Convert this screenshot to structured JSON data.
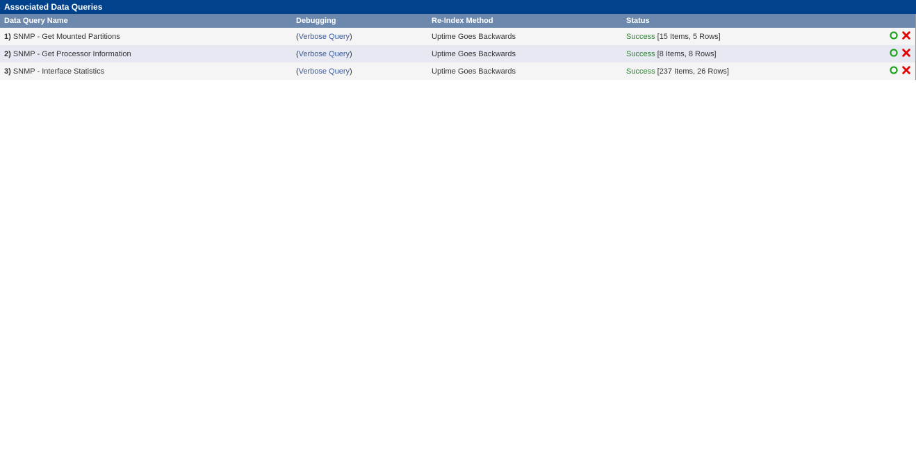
{
  "panel": {
    "title": "Associated Data Queries"
  },
  "table": {
    "headers": {
      "name": "Data Query Name",
      "debugging": "Debugging",
      "reindex": "Re-Index Method",
      "status": "Status"
    },
    "verbose_label": "Verbose Query",
    "rows": [
      {
        "num": "1)",
        "name": "SNMP - Get Mounted Partitions",
        "reindex": "Uptime Goes Backwards",
        "status_label": "Success",
        "status_detail": "[15 Items, 5 Rows]"
      },
      {
        "num": "2)",
        "name": "SNMP - Get Processor Information",
        "reindex": "Uptime Goes Backwards",
        "status_label": "Success",
        "status_detail": "[8 Items, 8 Rows]"
      },
      {
        "num": "3)",
        "name": "SNMP - Interface Statistics",
        "reindex": "Uptime Goes Backwards",
        "status_label": "Success",
        "status_detail": "[237 Items, 26 Rows]"
      }
    ]
  }
}
